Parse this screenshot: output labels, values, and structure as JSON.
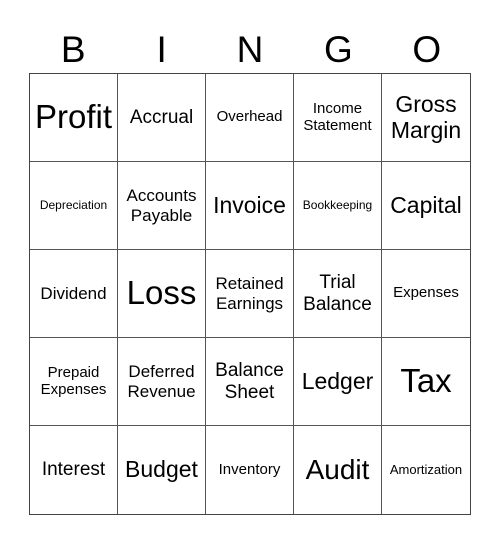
{
  "header": {
    "letters": [
      "B",
      "I",
      "N",
      "G",
      "O"
    ]
  },
  "board": {
    "rows": [
      [
        "Profit",
        "Accrual",
        "Overhead",
        "Income Statement",
        "Gross Margin"
      ],
      [
        "Depreciation",
        "Accounts Payable",
        "Invoice",
        "Bookkeeping",
        "Capital"
      ],
      [
        "Dividend",
        "Loss",
        "Retained Earnings",
        "Trial Balance",
        "Expenses"
      ],
      [
        "Prepaid Expenses",
        "Deferred Revenue",
        "Balance Sheet",
        "Ledger",
        "Tax"
      ],
      [
        "Interest",
        "Budget",
        "Inventory",
        "Audit",
        "Amortization"
      ]
    ]
  }
}
